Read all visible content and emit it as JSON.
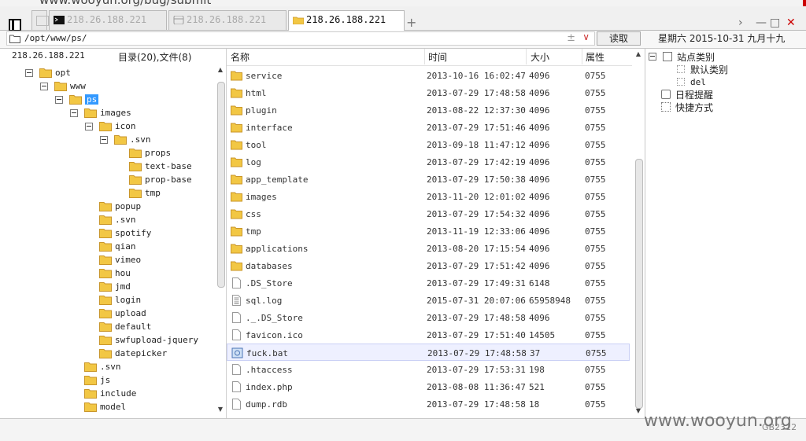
{
  "browser": {
    "url_fragment": "www.wooyun.org/bug/submit"
  },
  "tabs": [
    {
      "label": "218.26.188.221",
      "icon": "terminal-icon",
      "active": false
    },
    {
      "label": "218.26.188.221",
      "icon": "database-icon",
      "active": false
    },
    {
      "label": "218.26.188.221",
      "icon": "folder-icon",
      "active": true
    }
  ],
  "window_controls": {
    "next": "›",
    "minimize": "—",
    "maximize": "□",
    "close": "✕"
  },
  "address": {
    "path": "/opt/www/ps/",
    "read_button": "读取",
    "date": "星期六 2015-10-31 九月十九"
  },
  "tree": {
    "host": "218.26.188.221",
    "counts": "目录(20),文件(8)",
    "nodes": [
      {
        "label": "opt",
        "level": 0,
        "expanded": true
      },
      {
        "label": "www",
        "level": 1,
        "expanded": true
      },
      {
        "label": "ps",
        "level": 2,
        "expanded": true,
        "selected": true
      },
      {
        "label": "images",
        "level": 3,
        "expanded": true
      },
      {
        "label": "icon",
        "level": 4,
        "expanded": true
      },
      {
        "label": ".svn",
        "level": 5,
        "expanded": true
      },
      {
        "label": "props",
        "level": 6
      },
      {
        "label": "text-base",
        "level": 6
      },
      {
        "label": "prop-base",
        "level": 6
      },
      {
        "label": "tmp",
        "level": 6
      },
      {
        "label": "popup",
        "level": 4
      },
      {
        "label": ".svn",
        "level": 4
      },
      {
        "label": "spotify",
        "level": 4
      },
      {
        "label": "qian",
        "level": 4
      },
      {
        "label": "vimeo",
        "level": 4
      },
      {
        "label": "hou",
        "level": 4
      },
      {
        "label": "jmd",
        "level": 4
      },
      {
        "label": "login",
        "level": 4
      },
      {
        "label": "upload",
        "level": 4
      },
      {
        "label": "default",
        "level": 4
      },
      {
        "label": "swfupload-jquery",
        "level": 4
      },
      {
        "label": "datepicker",
        "level": 4
      },
      {
        "label": ".svn",
        "level": 3
      },
      {
        "label": "js",
        "level": 3
      },
      {
        "label": "include",
        "level": 3
      },
      {
        "label": "model",
        "level": 3
      }
    ]
  },
  "list": {
    "headers": {
      "name": "名称",
      "time": "时间",
      "size": "大小",
      "perm": "属性"
    },
    "rows": [
      {
        "name": "service",
        "type": "folder",
        "time": "2013-10-16 16:02:47",
        "size": "4096",
        "perm": "0755"
      },
      {
        "name": "html",
        "type": "folder",
        "time": "2013-07-29 17:48:58",
        "size": "4096",
        "perm": "0755"
      },
      {
        "name": "plugin",
        "type": "folder",
        "time": "2013-08-22 12:37:30",
        "size": "4096",
        "perm": "0755"
      },
      {
        "name": "interface",
        "type": "folder",
        "time": "2013-07-29 17:51:46",
        "size": "4096",
        "perm": "0755"
      },
      {
        "name": "tool",
        "type": "folder",
        "time": "2013-09-18 11:47:12",
        "size": "4096",
        "perm": "0755"
      },
      {
        "name": "log",
        "type": "folder",
        "time": "2013-07-29 17:42:19",
        "size": "4096",
        "perm": "0755"
      },
      {
        "name": "app_template",
        "type": "folder",
        "time": "2013-07-29 17:50:38",
        "size": "4096",
        "perm": "0755"
      },
      {
        "name": "images",
        "type": "folder",
        "time": "2013-11-20 12:01:02",
        "size": "4096",
        "perm": "0755"
      },
      {
        "name": "css",
        "type": "folder",
        "time": "2013-07-29 17:54:32",
        "size": "4096",
        "perm": "0755"
      },
      {
        "name": "tmp",
        "type": "folder",
        "time": "2013-11-19 12:33:06",
        "size": "4096",
        "perm": "0755"
      },
      {
        "name": "applications",
        "type": "folder",
        "time": "2013-08-20 17:15:54",
        "size": "4096",
        "perm": "0755"
      },
      {
        "name": "databases",
        "type": "folder",
        "time": "2013-07-29 17:51:42",
        "size": "4096",
        "perm": "0755"
      },
      {
        "name": ".DS_Store",
        "type": "file",
        "time": "2013-07-29 17:49:31",
        "size": "6148",
        "perm": "0755"
      },
      {
        "name": "sql.log",
        "type": "text",
        "time": "2015-07-31 20:07:06",
        "size": "65958948",
        "perm": "0755"
      },
      {
        "name": "._.DS_Store",
        "type": "file",
        "time": "2013-07-29 17:48:58",
        "size": "4096",
        "perm": "0755"
      },
      {
        "name": "favicon.ico",
        "type": "file",
        "time": "2013-07-29 17:51:40",
        "size": "14505",
        "perm": "0755"
      },
      {
        "name": "fuck.bat",
        "type": "bat",
        "time": "2013-07-29 17:48:58",
        "size": "37",
        "perm": "0755",
        "selected": true
      },
      {
        "name": ".htaccess",
        "type": "file",
        "time": "2013-07-29 17:53:31",
        "size": "198",
        "perm": "0755"
      },
      {
        "name": "index.php",
        "type": "file",
        "time": "2013-08-08 11:36:47",
        "size": "521",
        "perm": "0755"
      },
      {
        "name": "dump.rdb",
        "type": "file",
        "time": "2013-07-29 17:48:58",
        "size": "18",
        "perm": "0755"
      }
    ]
  },
  "sidebar": {
    "category": "站点类别",
    "default_category": "默认类别",
    "del": "del",
    "reminder": "日程提醒",
    "shortcut": "快捷方式"
  },
  "status": {
    "watermark": "www.wooyun.org",
    "charset": "GB2312"
  },
  "colors": {
    "folder": "#f2c744",
    "folder_edge": "#c9962a",
    "selection": "#3399ff",
    "row_selected": "#eef0ff"
  }
}
